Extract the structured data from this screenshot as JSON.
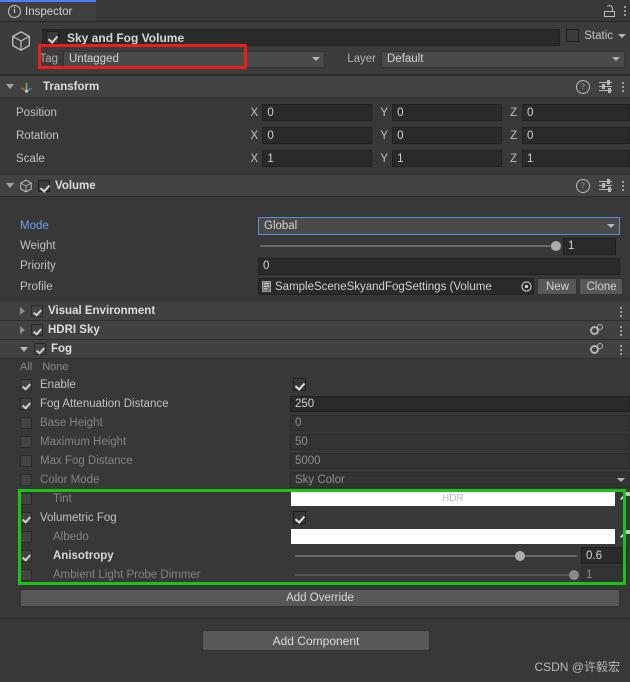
{
  "window": {
    "tab_label": "Inspector",
    "tab_icon": "info-icon",
    "lock_icon": "lock-open-icon",
    "menu_icon": "kebab-menu-icon"
  },
  "game_object": {
    "enabled": true,
    "name": "Sky and Fog Volume",
    "static_label": "Static",
    "static_checked": false,
    "tag_label": "Tag",
    "tag_value": "Untagged",
    "layer_label": "Layer",
    "layer_value": "Default",
    "highlight_color": "#ee1d1d"
  },
  "transform": {
    "title": "Transform",
    "expanded": true,
    "rows": [
      {
        "label": "Position",
        "x": "0",
        "y": "0",
        "z": "0"
      },
      {
        "label": "Rotation",
        "x": "0",
        "y": "0",
        "z": "0"
      },
      {
        "label": "Scale",
        "x": "1",
        "y": "1",
        "z": "1"
      }
    ],
    "axis_labels": {
      "x": "X",
      "y": "Y",
      "z": "Z"
    }
  },
  "volume": {
    "title": "Volume",
    "enabled": true,
    "expanded": true,
    "mode": {
      "label": "Mode",
      "value": "Global",
      "overridden": true
    },
    "weight": {
      "label": "Weight",
      "value": "1",
      "fraction": 1.0
    },
    "priority": {
      "label": "Priority",
      "value": "0"
    },
    "profile": {
      "label": "Profile",
      "value": "SampleSceneSkyandFogSettings (Volume",
      "new_button": "New",
      "clone_button": "Clone"
    },
    "overrides": [
      {
        "name": "Visual Environment",
        "expanded": false,
        "enabled": true,
        "has_gear": false
      },
      {
        "name": "HDRI Sky",
        "expanded": false,
        "enabled": true,
        "has_gear": true
      },
      {
        "name": "Fog",
        "expanded": true,
        "enabled": true,
        "has_gear": true
      }
    ],
    "fog": {
      "all_label": "All",
      "none_label": "None",
      "properties": [
        {
          "label": "Enable",
          "checked": true,
          "type": "toggle",
          "value": "",
          "toggle_on": true,
          "dim": false,
          "indent": 0,
          "bold": false
        },
        {
          "label": "Fog Attenuation Distance",
          "checked": true,
          "type": "text",
          "value": "250",
          "dim": false,
          "indent": 0,
          "bold": false
        },
        {
          "label": "Base Height",
          "checked": false,
          "type": "text",
          "value": "0",
          "dim": true,
          "indent": 0,
          "bold": false
        },
        {
          "label": "Maximum Height",
          "checked": false,
          "type": "text",
          "value": "50",
          "dim": true,
          "indent": 0,
          "bold": false
        },
        {
          "label": "Max Fog Distance",
          "checked": false,
          "type": "text",
          "value": "5000",
          "dim": true,
          "indent": 0,
          "bold": false
        },
        {
          "label": "Color Mode",
          "checked": false,
          "type": "dropdown",
          "value": "Sky Color",
          "dim": true,
          "indent": 0,
          "bold": false
        },
        {
          "label": "Tint",
          "checked": false,
          "type": "color",
          "value": "HDR",
          "color": "#ffffff",
          "dim": true,
          "indent": 1,
          "bold": false
        },
        {
          "label": "Volumetric Fog",
          "checked": true,
          "type": "toggle",
          "value": "",
          "toggle_on": true,
          "dim": false,
          "indent": 0,
          "bold": false
        },
        {
          "label": "Albedo",
          "checked": false,
          "type": "color",
          "value": "",
          "color": "#ffffff",
          "dim": true,
          "indent": 1,
          "bold": false
        },
        {
          "label": "Anisotropy",
          "checked": true,
          "type": "slider",
          "value": "0.6",
          "fraction": 0.78,
          "dim": false,
          "indent": 1,
          "bold": true
        },
        {
          "label": "Ambient Light Probe Dimmer",
          "checked": false,
          "type": "slider",
          "value": "1",
          "fraction": 1.0,
          "dim": true,
          "indent": 1,
          "bold": false
        }
      ],
      "highlight_color": "#19c419"
    },
    "add_override_label": "Add Override"
  },
  "footer": {
    "add_component_label": "Add Component",
    "watermark": "CSDN @许毅宏"
  }
}
